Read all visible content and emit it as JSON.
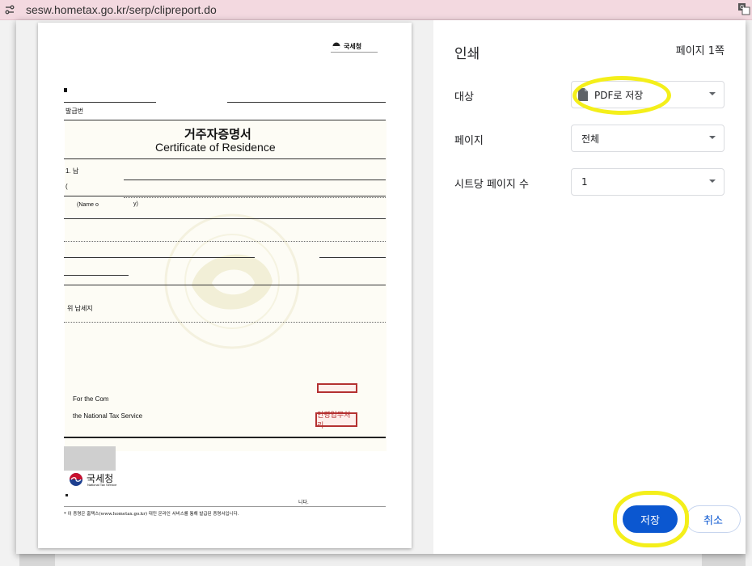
{
  "browser": {
    "url": "sesw.hometax.go.kr/serp/clipreport.do"
  },
  "print_dialog": {
    "title": "인쇄",
    "sheet_count": "페이지 1쪽",
    "destination": {
      "label": "대상",
      "value": "PDF로 저장"
    },
    "pages": {
      "label": "페이지",
      "value": "전체"
    },
    "pages_per_sheet": {
      "label": "시트당 페이지 수",
      "value": "1"
    },
    "save_label": "저장",
    "cancel_label": "취소"
  },
  "certificate": {
    "header_logo_text": "국세청",
    "issue_label": "발급번",
    "title_ko": "거주자증명서",
    "title_en": "Certificate of Residence",
    "field_1": "1. 납",
    "field_paren": "(",
    "name_fragment": "(Name o",
    "name_fragment2": "y)",
    "above_fragment": "위 납세지",
    "for_fragment": "For the Com",
    "nts_text": "the National Tax Service",
    "stamp_text": "인영업무처리",
    "footer_logo_text": "국세청",
    "footer_logo_sub": "National Tax Service",
    "footnote_end": "니다.",
    "footnote": "* 이 증명은 홈택스(www.hometax.go.kr) 대민 온라인 서비스를 통해 발급된 증명서입니다."
  },
  "colors": {
    "highlight": "#f4ef1a",
    "primary_button": "#0b57d0",
    "urlbar_bg": "#f3d9e0",
    "stamp_red": "#b43131"
  }
}
